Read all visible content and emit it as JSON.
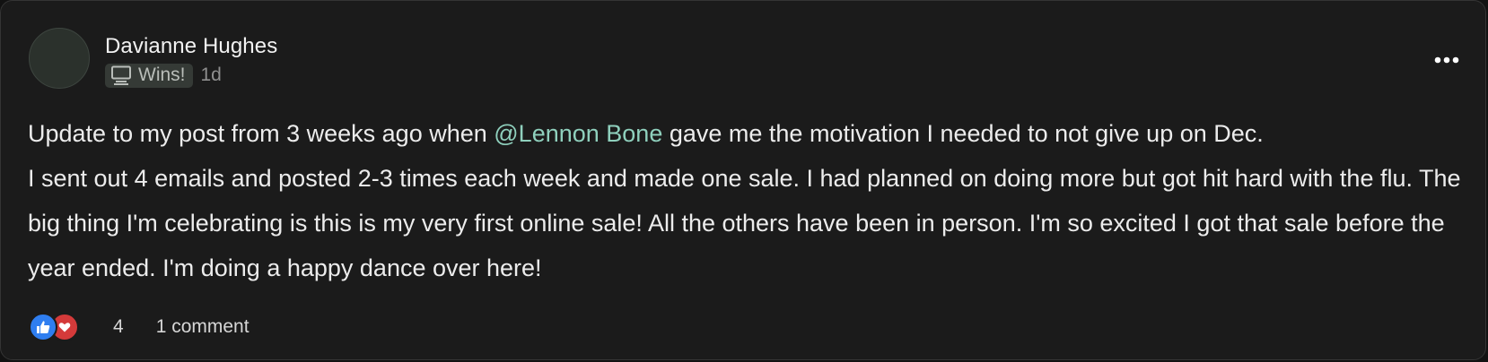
{
  "post": {
    "author": "Davianne Hughes",
    "category_badge": "Wins!",
    "category_icon": "monitor-icon",
    "time_ago": "1d",
    "mention": "@Lennon Bone",
    "line1_before": "Update to my post from 3 weeks ago when ",
    "line1_after": " gave me the motivation I needed to not give up on Dec.",
    "paragraph2": "I sent out 4 emails and posted 2-3 times each week and made one sale. I had planned on doing more but got hit hard with the flu. The big thing I'm celebrating is this is my very first online sale! All the others have been in person. I'm so excited I got that sale before the year ended. I'm doing a happy dance over here!"
  },
  "footer": {
    "reaction_icons": [
      "thumbs-up-icon",
      "heart-icon"
    ],
    "reaction_count": "4",
    "comments_label": "1 comment"
  },
  "colors": {
    "background": "#1b1b1b",
    "mention": "#8fd0bd",
    "like": "#2f7ef0",
    "love": "#d43a3a"
  }
}
